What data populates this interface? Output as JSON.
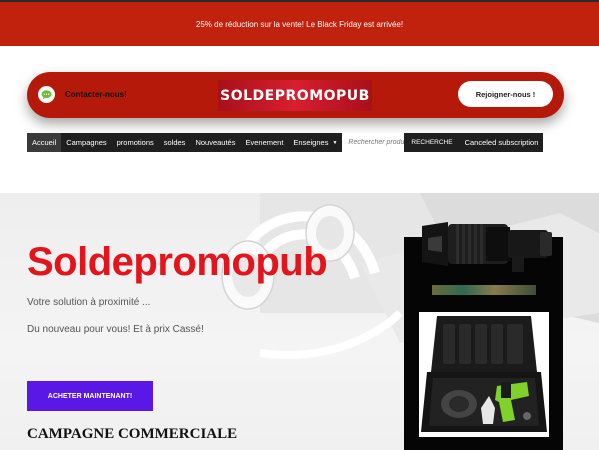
{
  "topbar": {
    "announcement": "25%  de réduction sur la vente! Le Black Friday est arrivée!"
  },
  "header": {
    "contact_label": "Contacter-nous!",
    "logo_text": "SOLDEPROMOPUB",
    "join_label": "Rejoigner-nous !"
  },
  "nav": {
    "items": [
      {
        "label": "Accueil",
        "active": true
      },
      {
        "label": "Campagnes"
      },
      {
        "label": "promotions"
      },
      {
        "label": "soldes"
      },
      {
        "label": "Nouveautés"
      },
      {
        "label": "Evenement"
      },
      {
        "label": "Enseignes",
        "has_dropdown": true
      }
    ],
    "search_placeholder": "Rechercher produits...",
    "search_button": "RECHERCHE",
    "extra_item": "Canceled subscription"
  },
  "hero": {
    "title": "Soldepromopub",
    "subtitle": "Votre solution à proximité ...",
    "subtitle2": "Du nouveau pour vous! Et à prix Cassé!",
    "cta_label": "ACHETER MAINTENANT!",
    "section_heading": "CAMPAGNE COMMERCIALE"
  },
  "colors": {
    "brand_red": "#c0220e",
    "hero_red": "#e3141b",
    "cta_purple": "#5a18e6",
    "chat_green": "#6bbd2a"
  },
  "icons": {
    "contact": "chat-bubble-icon",
    "dropdown": "caret-down-icon",
    "product_lens": "camera-lens-icon",
    "product_case": "tool-case-icon"
  }
}
